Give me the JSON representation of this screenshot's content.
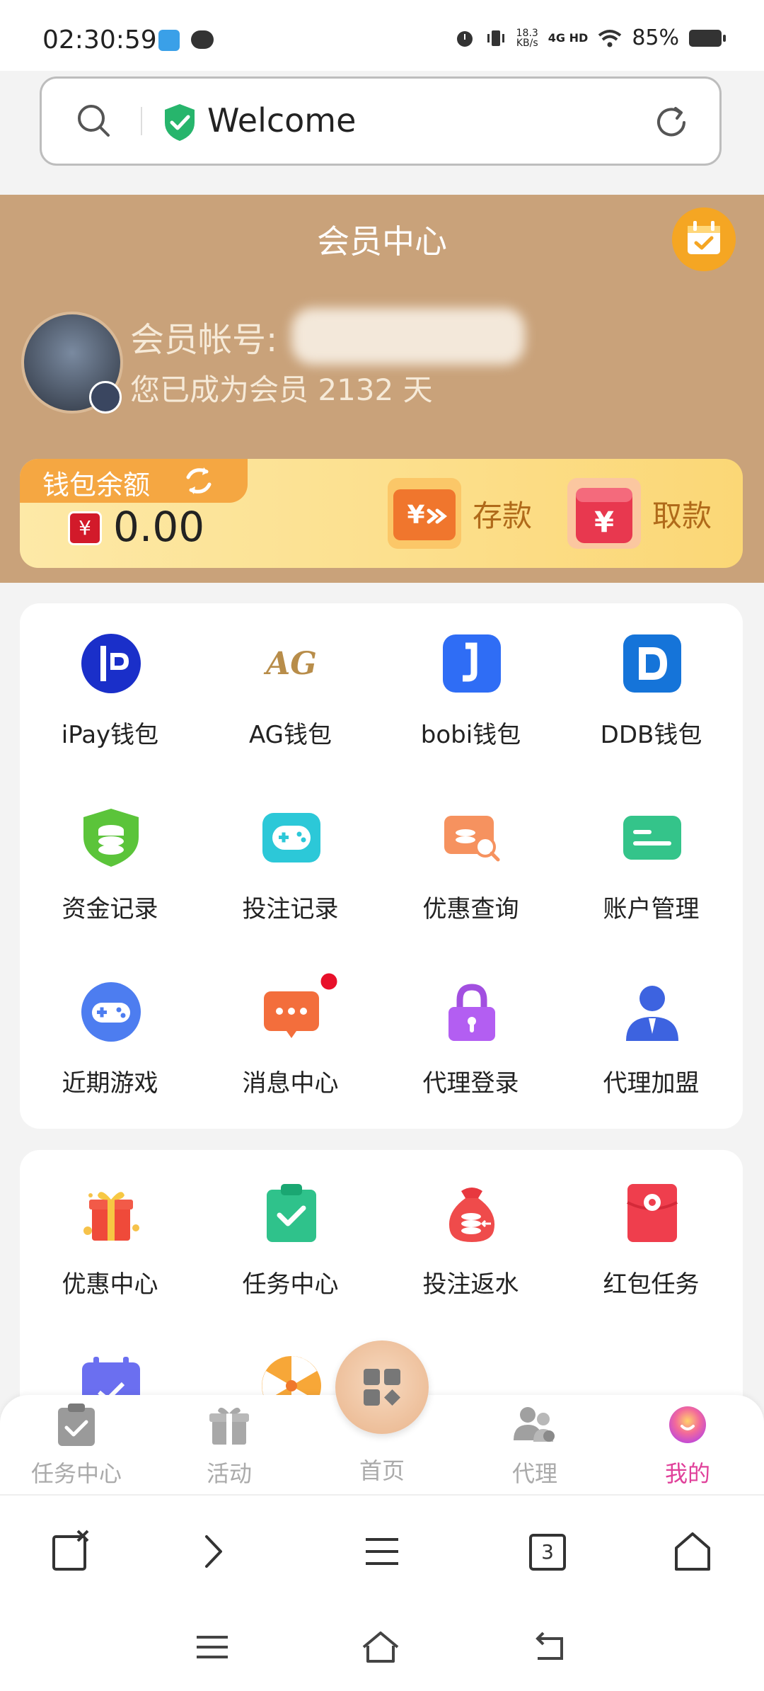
{
  "status_bar": {
    "time": "02:30:59",
    "net_speed_value": "18.3",
    "net_speed_unit": "KB/s",
    "network": "4G HD",
    "battery": "85%"
  },
  "address_bar": {
    "text": "Welcome"
  },
  "member": {
    "title": "会员中心",
    "account_label": "会员帐号:",
    "days_text": "您已成为会员 2132 天",
    "wallet_label": "钱包余额",
    "currency_symbol": "¥",
    "balance": "0.00",
    "deposit_label": "存款",
    "withdraw_label": "取款"
  },
  "menu1": [
    {
      "label": "iPay钱包"
    },
    {
      "label": "AG钱包"
    },
    {
      "label": "bobi钱包"
    },
    {
      "label": "DDB钱包"
    },
    {
      "label": "资金记录"
    },
    {
      "label": "投注记录"
    },
    {
      "label": "优惠查询"
    },
    {
      "label": "账户管理"
    },
    {
      "label": "近期游戏"
    },
    {
      "label": "消息中心"
    },
    {
      "label": "代理登录"
    },
    {
      "label": "代理加盟"
    }
  ],
  "menu2": [
    {
      "label": "优惠中心"
    },
    {
      "label": "任务中心"
    },
    {
      "label": "投注返水"
    },
    {
      "label": "红包任务"
    }
  ],
  "bottom_nav": {
    "tasks": "任务中心",
    "activity": "活动",
    "home": "首页",
    "agent": "代理",
    "mine": "我的"
  },
  "browser_bar": {
    "tab_count": "3"
  },
  "colors": {
    "header_bg": "#c9a27a",
    "active_nav": "#e0409a",
    "inactive_nav": "#aaaaaa"
  }
}
